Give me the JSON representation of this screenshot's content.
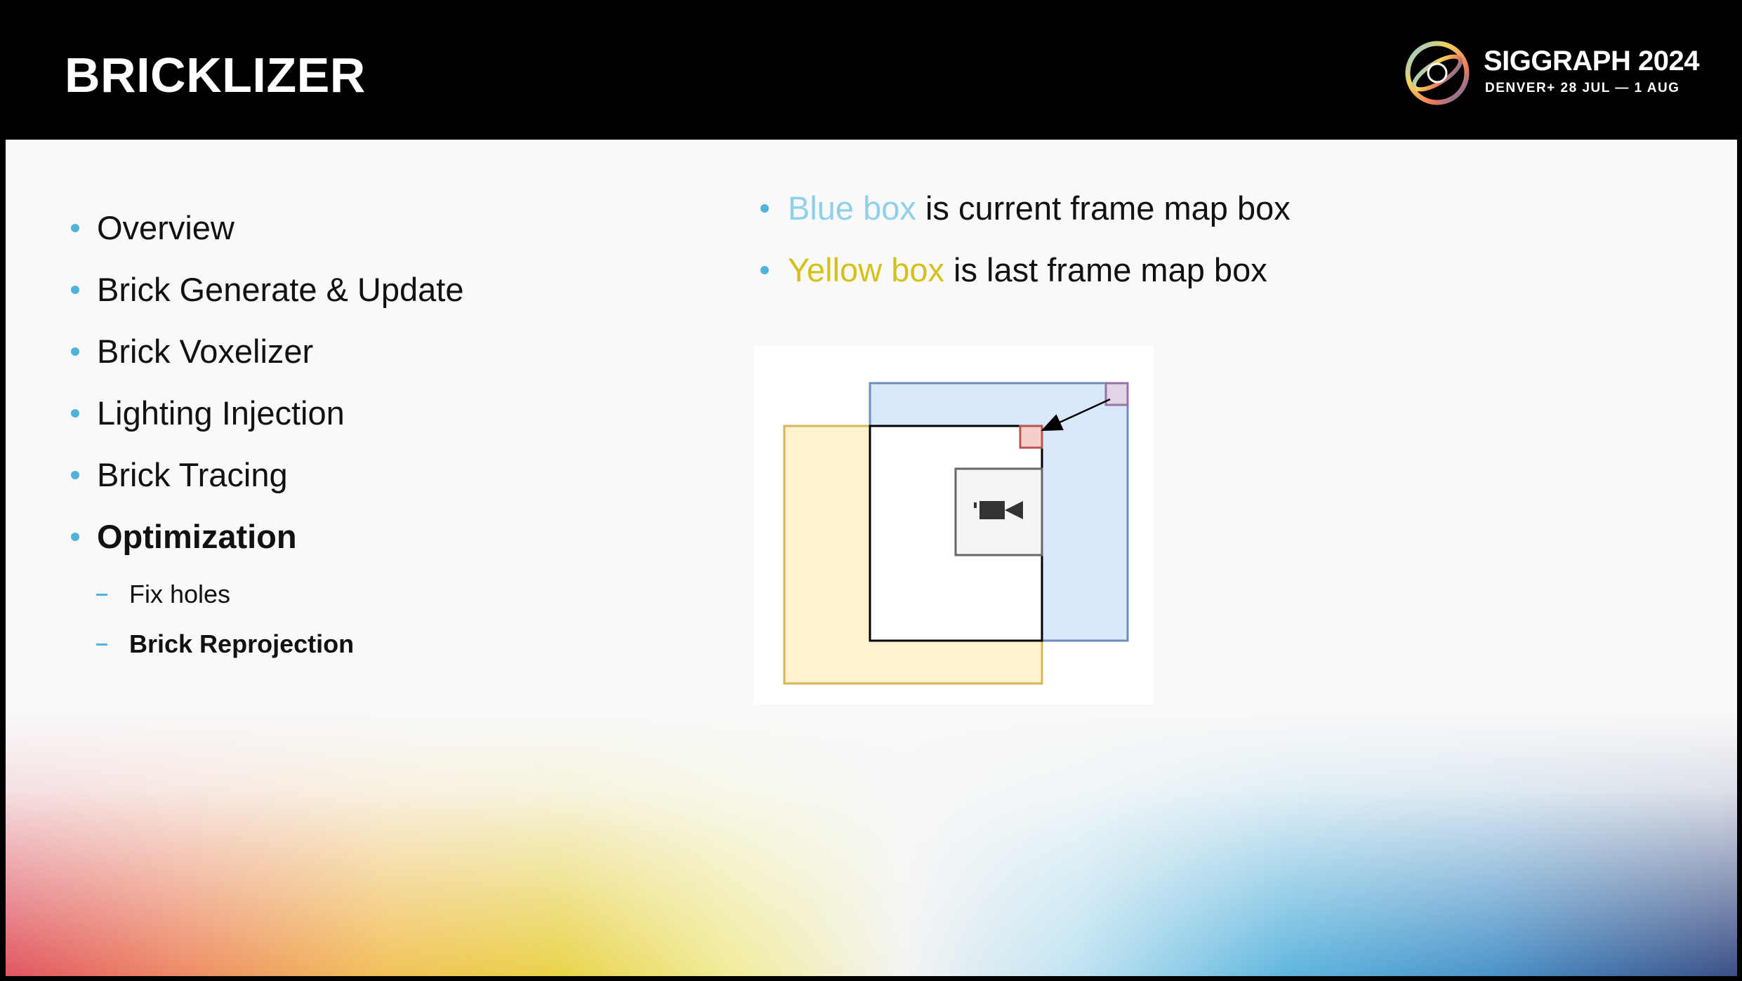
{
  "header": {
    "title": "BRICKLIZER",
    "logo": {
      "name": "SIGGRAPH 2024",
      "tagline": "DENVER+ 28 JUL — 1 AUG",
      "icon": "siggraph-logo-icon"
    }
  },
  "left_list": {
    "items": [
      {
        "label": "Overview",
        "bold": false
      },
      {
        "label": "Brick Generate & Update",
        "bold": false
      },
      {
        "label": "Brick Voxelizer",
        "bold": false
      },
      {
        "label": "Lighting Injection",
        "bold": false
      },
      {
        "label": "Brick Tracing",
        "bold": false
      },
      {
        "label": "Optimization",
        "bold": true
      }
    ],
    "subitems": [
      {
        "label": "Fix holes",
        "bold": false
      },
      {
        "label": "Brick Reprojection",
        "bold": true
      }
    ]
  },
  "right_list": {
    "items": [
      {
        "highlight": "Blue box",
        "rest": " is current frame map box",
        "highlight_color": "#8fd0ea"
      },
      {
        "highlight": "Yellow box",
        "rest": " is last frame map box",
        "highlight_color": "#d4c21a"
      }
    ]
  },
  "diagram": {
    "boxes": [
      "yellow-box",
      "blue-box",
      "black-box",
      "camera-box",
      "red-square",
      "purple-square"
    ],
    "camera_icon": "video-camera-icon",
    "colors": {
      "blue_fill": "#dae8fc",
      "blue_stroke": "#6c8ebf",
      "yellow_fill": "#fff2cc",
      "yellow_stroke": "#d6b656",
      "red_fill": "#f8cecc",
      "red_stroke": "#b85450",
      "purple_fill": "#e1d5e7",
      "purple_stroke": "#9673a6"
    }
  },
  "colors": {
    "bullet": "#4fb3da",
    "header_bg": "#000000",
    "content_bg": "#f9f9f9"
  }
}
